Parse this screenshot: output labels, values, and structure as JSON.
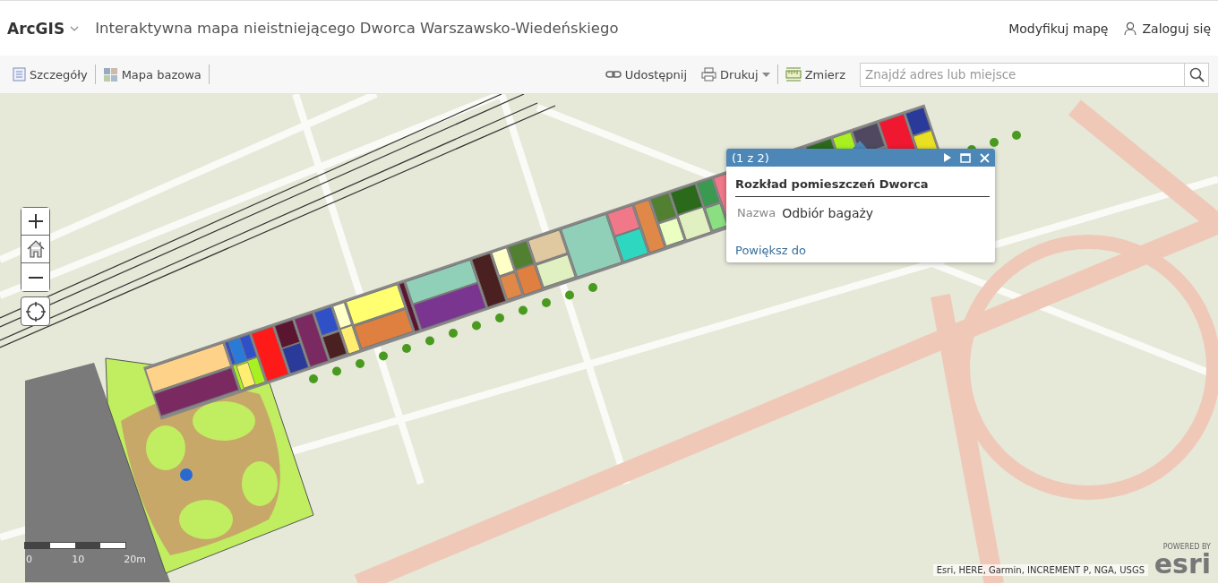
{
  "header": {
    "brand": "ArcGIS",
    "title": "Interaktywna mapa nieistniejącego Dworca Warszawsko-Wiedeńskiego",
    "actions": [
      "Modyfikuj mapę",
      "Zaloguj się"
    ]
  },
  "toolbar": {
    "left": [
      {
        "kind": "details",
        "label": "Szczegóły"
      },
      {
        "kind": "basemap",
        "label": "Mapa bazowa"
      }
    ],
    "right": [
      {
        "kind": "share",
        "label": "Udostępnij"
      },
      {
        "kind": "print",
        "label": "Drukuj"
      },
      {
        "kind": "measure",
        "label": "Zmierz"
      }
    ],
    "search": {
      "placeholder": "Znajdź adres lub miejsce"
    }
  },
  "popup": {
    "pager": "(1 z 2)",
    "title": "Rozkład pomieszczeń Dworca",
    "fields": [
      {
        "name": "Nazwa",
        "value": "Odbiór bagaży"
      }
    ],
    "link": "Powiększ do"
  },
  "scale_bar": {
    "ticks": [
      "0",
      "10",
      "20m"
    ]
  },
  "attribution": "Esri, HERE, Garmin, INCREMENT P, NGA, USGS",
  "logo": {
    "caption": "POWERED BY",
    "name": "esri"
  }
}
